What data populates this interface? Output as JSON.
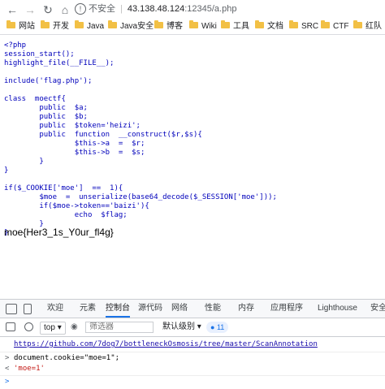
{
  "browser": {
    "security_label": "不安全",
    "host": "43.138.48.124",
    "path": ":12345/a.php",
    "bookmarks": [
      "网站",
      "开发",
      "Java",
      "Java安全",
      "博客",
      "Wiki",
      "工具",
      "文档",
      "SRC",
      "CTF",
      "红队"
    ]
  },
  "page": {
    "source_code": "<?php\nsession_start();\nhighlight_file(__FILE__);\n\ninclude('flag.php');\n\nclass  moectf{\n        public  $a;\n        public  $b;\n        public  $token='heizi';\n        public  function  __construct($r,$s){\n                $this->a  =  $r;\n                $this->b  =  $s;\n        }\n}\n\nif($_COOKIE['moe']  ==  1){\n        $moe  =  unserialize(base64_decode($_SESSION['moe']));\n        if($moe->token=='baizi'){\n                echo  $flag;\n        }\n}",
    "output": "moe{Her3_1s_Y0ur_fl4g}"
  },
  "devtools": {
    "tabs": [
      "欢迎",
      "元素",
      "控制台",
      "源代码",
      "网络",
      "性能",
      "内存",
      "应用程序",
      "Lighthouse",
      "安全"
    ],
    "active_tab": "控制台",
    "context": "top",
    "filter_placeholder": "筛选器",
    "level": "默认级别",
    "issues_count": "11",
    "console_lines": {
      "link": "https://github.com/7dog7/bottleneckOsmosis/tree/master/ScanAnnotation",
      "input_prefix": ">",
      "input_code": "document.cookie=\"moe=1\";",
      "result_prefix": "<",
      "result_value": "'moe=1'",
      "prompt_prefix": ">"
    }
  },
  "colors": {
    "accent": "#1a73e8",
    "code_text": "#0000bb",
    "string_result": "#c41a16"
  }
}
